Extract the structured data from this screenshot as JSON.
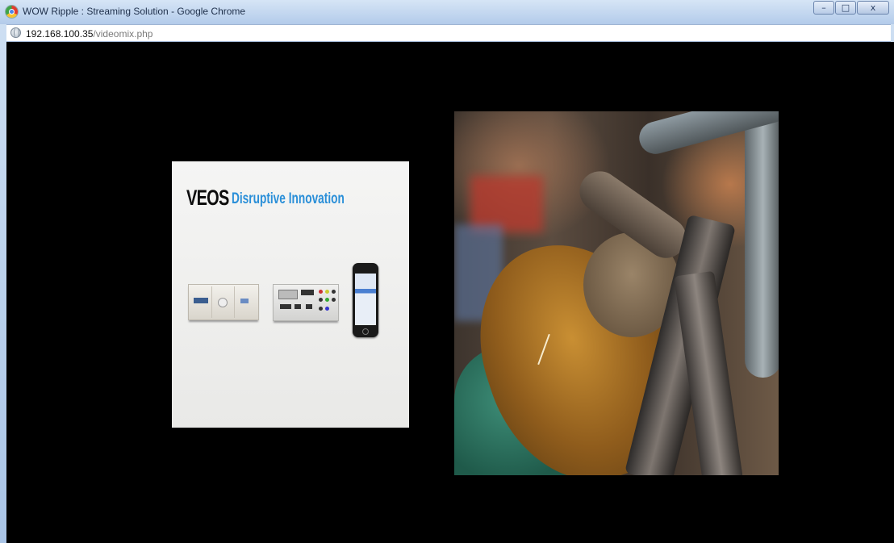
{
  "window": {
    "title": "WOW Ripple : Streaming Solution - Google Chrome",
    "controls": {
      "minimize": "–",
      "maximize": "□",
      "close": "x"
    }
  },
  "addressbar": {
    "host": "192.168.100.35",
    "path": "/videomix.php",
    "icon": "globe-icon"
  },
  "video_left": {
    "logo": "VEOS",
    "tagline": "Disruptive Innovation",
    "accent_color": "#2a8fd8"
  },
  "video_right": {
    "description_icon": "welding-video-frame"
  }
}
